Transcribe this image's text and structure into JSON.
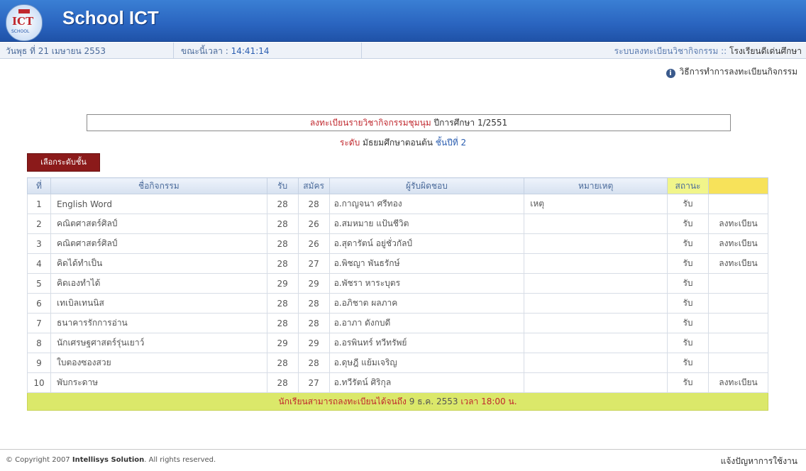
{
  "header": {
    "app_title": "School ICT",
    "logo_text": "ICT",
    "logo_sub": "SCHOOL"
  },
  "infobar": {
    "date": "วันพุธ ที่ 21 เมษายน 2553",
    "time_label": "ขณะนี้เวลา :",
    "time": "14:41:14",
    "system": "ระบบลงทะเบียนวิชากิจกรรม",
    "separator": "::",
    "school": "โรงเรียนดีเด่นศึกษา"
  },
  "howto": {
    "label": "วิธีการทำการลงทะเบียนกิจกรรม"
  },
  "title": {
    "prefix": "ลงทะเบียนรายวิชากิจกรรมชุมนุม",
    "year_label": "ปีการศึกษา",
    "year": "1/2551"
  },
  "subtitle": {
    "level_label": "ระดับ",
    "level": "มัธยมศึกษาตอนต้น",
    "grade_label": "ชั้นปีที่",
    "grade": "2"
  },
  "level_button": "เลือกระดับชั้น",
  "table": {
    "headers": [
      "ที่",
      "ชื่อกิจกรรม",
      "รับ",
      "สมัคร",
      "ผู้รับผิดชอบ",
      "หมายเหตุ",
      "สถานะ",
      ""
    ],
    "rows": [
      {
        "no": "1",
        "name": "English Word",
        "accept": "28",
        "applied": "28",
        "teacher": "อ.กาญจนา ศรีทอง",
        "note": "เหตุ",
        "status": "รับ",
        "action": ""
      },
      {
        "no": "2",
        "name": "คณิตศาสตร์ศิลป์",
        "accept": "28",
        "applied": "26",
        "teacher": "อ.สมหมาย แป้นชีวิต",
        "note": "",
        "status": "รับ",
        "action": "ลงทะเบียน"
      },
      {
        "no": "3",
        "name": "คณิตศาสตร์ศิลป์",
        "accept": "28",
        "applied": "26",
        "teacher": "อ.สุดารัตน์ อยู่ชั่วกัลป์",
        "note": "",
        "status": "รับ",
        "action": "ลงทะเบียน"
      },
      {
        "no": "4",
        "name": "คิดได้ทำเป็น",
        "accept": "28",
        "applied": "27",
        "teacher": "อ.พิชญา พันธรักษ์",
        "note": "",
        "status": "รับ",
        "action": "ลงทะเบียน"
      },
      {
        "no": "5",
        "name": "คิดเองทำได้",
        "accept": "29",
        "applied": "29",
        "teacher": "อ.พัชรา หาระบุตร",
        "note": "",
        "status": "รับ",
        "action": ""
      },
      {
        "no": "6",
        "name": "เทเบิลเทนนิส",
        "accept": "28",
        "applied": "28",
        "teacher": "อ.อภิชาต ผลภาค",
        "note": "",
        "status": "รับ",
        "action": ""
      },
      {
        "no": "7",
        "name": "ธนาคารรักการอ่าน",
        "accept": "28",
        "applied": "28",
        "teacher": "อ.อาภา ดังกบดี",
        "note": "",
        "status": "รับ",
        "action": ""
      },
      {
        "no": "8",
        "name": "นักเศรษฐศาสตร์รุ่นเยาว์",
        "accept": "29",
        "applied": "29",
        "teacher": "อ.อรพินทร์ ทวีทรัพย์",
        "note": "",
        "status": "รับ",
        "action": ""
      },
      {
        "no": "9",
        "name": "ใบตองซองสวย",
        "accept": "28",
        "applied": "28",
        "teacher": "อ.ดุษฎี แย้มเจริญ",
        "note": "",
        "status": "รับ",
        "action": ""
      },
      {
        "no": "10",
        "name": "พับกระดาษ",
        "accept": "28",
        "applied": "27",
        "teacher": "อ.ทวีรัตน์ ศิริกุล",
        "note": "",
        "status": "รับ",
        "action": "ลงทะเบียน"
      }
    ],
    "footer": {
      "prefix": "นักเรียนสามารถลงทะเบียนได้จนถึง",
      "date": "9 ธ.ค. 2553",
      "time_label": "เวลา",
      "time": "18:00 น."
    }
  },
  "footer": {
    "copyright_pre": "© Copyright 2007",
    "company": "Intellisys Solution",
    "copyright_post": ". All rights reserved.",
    "report": "แจ้งปัญหาการใช้งาน"
  }
}
